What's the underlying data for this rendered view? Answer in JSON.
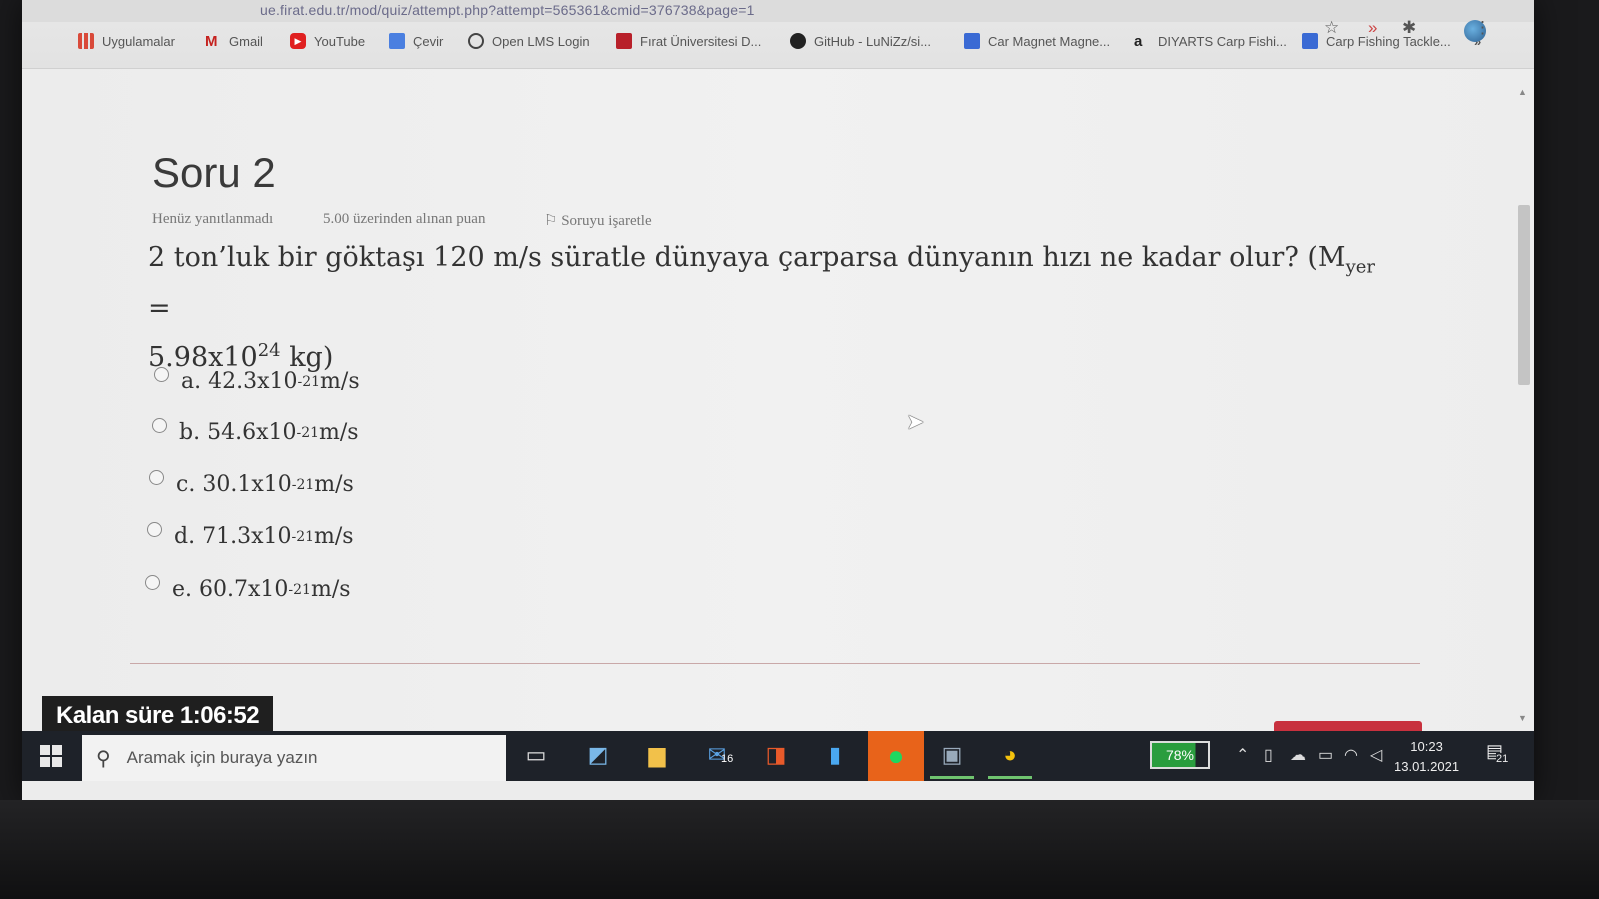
{
  "browser": {
    "url": "ue.firat.edu.tr/mod/quiz/attempt.php?attempt=565361&cmid=376738&page=1",
    "bookmarks": [
      {
        "label": "Uygulamalar",
        "icon": "apps-grid-icon",
        "color": "#d94a3a"
      },
      {
        "label": "Gmail",
        "icon": "gmail-icon",
        "color": "#c5221f"
      },
      {
        "label": "YouTube",
        "icon": "youtube-icon",
        "color": "#e02020"
      },
      {
        "label": "Çevir",
        "icon": "translate-icon",
        "color": "#4a7fe0"
      },
      {
        "label": "Open LMS Login",
        "icon": "globe-icon",
        "color": "#444444"
      },
      {
        "label": "Fırat Üniversitesi D...",
        "icon": "firat-logo-icon",
        "color": "#b8202a"
      },
      {
        "label": "GitHub - LuNiZz/si...",
        "icon": "github-icon",
        "color": "#222222"
      },
      {
        "label": "Car Magnet Magne...",
        "icon": "shopping-bag-icon",
        "color": "#3a6ad4"
      },
      {
        "label": "DIYARTS Carp Fishi...",
        "icon": "amazon-icon",
        "color": "#222222"
      },
      {
        "label": "Carp Fishing Tackle...",
        "icon": "shopping-bag-icon",
        "color": "#3a6ad4"
      }
    ],
    "overflow_label": "»"
  },
  "question": {
    "title": "Soru 2",
    "status": "Henüz yanıtlanmadı",
    "points": "5.00 üzerinden alınan puan",
    "flag_label": "Soruyu işaretle",
    "text_part1": "2 ton’luk bir göktaşı 120 m/s süratle dünyaya çarparsa dünyanın hızı ne kadar olur? (M",
    "text_sub": "yer",
    "text_part2": " =",
    "text_line2": "5.98x10",
    "text_sup": "24",
    "text_line2_end": " kg)",
    "options": [
      {
        "letter": "a.",
        "value": "42.3x10",
        "exp": "-21",
        "unit": " m/s"
      },
      {
        "letter": "b.",
        "value": "54.6x10",
        "exp": "-21",
        "unit": " m/s"
      },
      {
        "letter": "c.",
        "value": "30.1x10",
        "exp": "-21",
        "unit": " m/s"
      },
      {
        "letter": "d.",
        "value": "71.3x10",
        "exp": "-21",
        "unit": " m/s"
      },
      {
        "letter": "e.",
        "value": "60.7x10",
        "exp": "-21",
        "unit": " m/s"
      }
    ]
  },
  "timer": {
    "label": "Kalan süre 1:06:52"
  },
  "taskbar": {
    "search_placeholder": "Aramak için buraya yazın",
    "mail_badge": "16",
    "battery": "78%",
    "battery_level": 0.78,
    "time": "10:23",
    "date": "13.01.2021",
    "notification_count": "21"
  }
}
